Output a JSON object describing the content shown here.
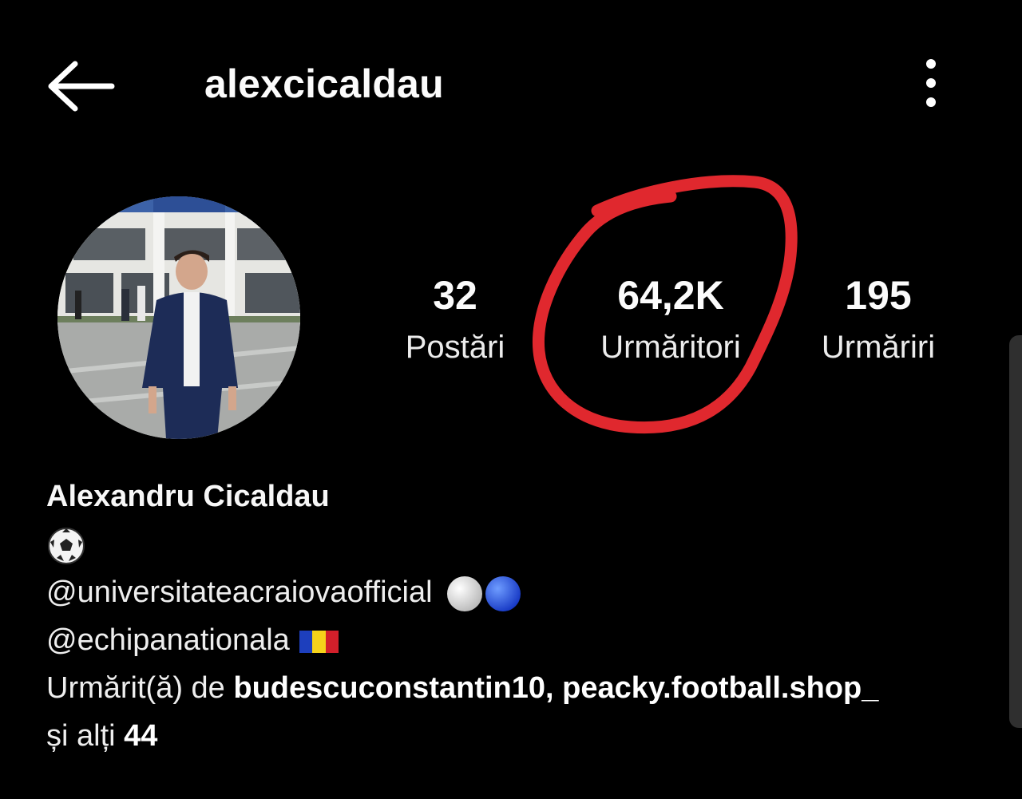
{
  "header": {
    "username": "alexcicaldau",
    "back_icon": "arrow-left-icon",
    "menu_icon": "more-vertical-icon"
  },
  "profile": {
    "avatar_alt": "profile-photo",
    "stats": [
      {
        "value": "32",
        "label": "Postări"
      },
      {
        "value": "64,2K",
        "label": "Urmăritori"
      },
      {
        "value": "195",
        "label": "Urmăriri"
      }
    ],
    "highlight_color": "#e0282e"
  },
  "bio": {
    "full_name": "Alexandru Cicaldau",
    "line1_emoji": "soccer-ball-icon",
    "mention1": "@universitateacraiovaofficial",
    "mention1_emoji": "white-circle-blue-circle-icons",
    "mention2": "@echipanationala",
    "mention2_emoji": "romania-flag-icon",
    "followed_by_prefix": "Urmărit(ă) de ",
    "followed_by_users": "budescuconstantin10, peacky.football.shop_",
    "others_prefix": "și alți ",
    "others_count": "44"
  }
}
